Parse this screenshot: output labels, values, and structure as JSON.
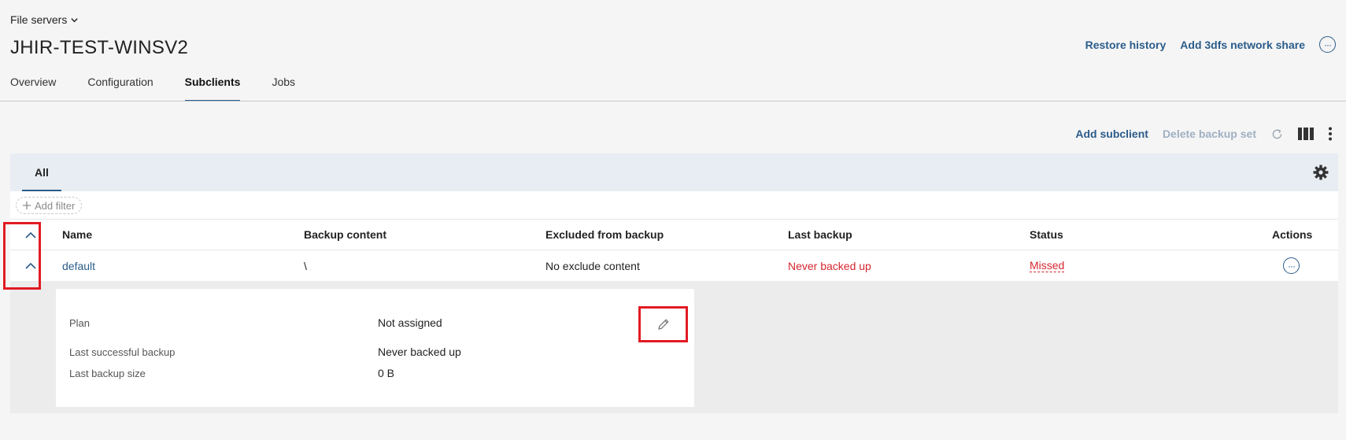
{
  "breadcrumb": {
    "label": "File servers"
  },
  "page": {
    "title": "JHIR-TEST-WINSV2"
  },
  "header_actions": {
    "restore_history": "Restore history",
    "add_share": "Add 3dfs network share",
    "more": "···"
  },
  "tabs": [
    {
      "label": "Overview"
    },
    {
      "label": "Configuration"
    },
    {
      "label": "Subclients"
    },
    {
      "label": "Jobs"
    }
  ],
  "active_tab": "Subclients",
  "toolbar": {
    "add_subclient": "Add subclient",
    "delete_backup_set": "Delete backup set",
    "icons": [
      "refresh-icon",
      "columns-icon",
      "kebab-menu-icon"
    ]
  },
  "view_tabs": {
    "all": "All"
  },
  "filter": {
    "add_filter": "Add filter"
  },
  "table": {
    "columns": {
      "name": "Name",
      "backup_content": "Backup content",
      "excluded": "Excluded from backup",
      "last_backup": "Last backup",
      "status": "Status",
      "actions": "Actions"
    },
    "rows": [
      {
        "name": "default",
        "backup_content": "\\",
        "excluded": "No exclude content",
        "last_backup": "Never backed up",
        "status": "Missed",
        "actions": "···"
      }
    ]
  },
  "details": {
    "plan_label": "Plan",
    "plan_value": "Not assigned",
    "last_success_label": "Last successful backup",
    "last_success_value": "Never backed up",
    "size_label": "Last backup size",
    "size_value": "0 B"
  },
  "colors": {
    "accent": "#2b5c8a",
    "error": "#d7262f",
    "highlight": "#e21b23"
  }
}
